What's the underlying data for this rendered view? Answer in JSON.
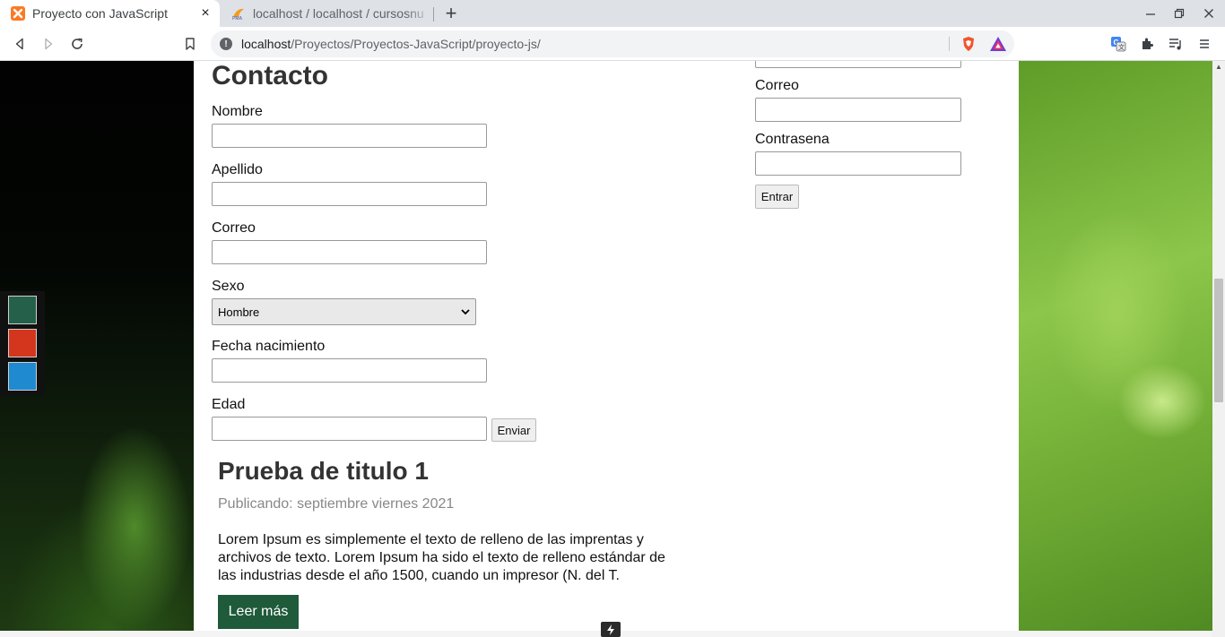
{
  "browser": {
    "tabs": [
      {
        "title": "Proyecto con JavaScript",
        "active": true,
        "favicon": "xampp-icon"
      },
      {
        "title": "localhost / localhost / cursosnu",
        "active": false,
        "favicon": "phpmyadmin-icon"
      }
    ],
    "url": {
      "host": "localhost",
      "path": "/Proyectos/Proyectos-JavaScript/proyecto-js/"
    },
    "new_tab_symbol": "+",
    "close_symbol": "×"
  },
  "theme_colors": [
    "#25604a",
    "#d3361c",
    "#1f8ad0"
  ],
  "contact_form": {
    "title": "Contacto",
    "fields": {
      "nombre": "Nombre",
      "apellido": "Apellido",
      "correo": "Correo",
      "sexo": "Sexo",
      "fecha": "Fecha nacimiento",
      "edad": "Edad"
    },
    "sexo_selected": "Hombre",
    "submit_label": "Enviar"
  },
  "login_form": {
    "correo_label": "Correo",
    "contrasena_label": "Contrasena",
    "submit_label": "Entrar"
  },
  "article": {
    "title": "Prueba de titulo 1",
    "date": "Publicando: septiembre viernes 2021",
    "body": "Lorem Ipsum es simplemente el texto de relleno de las imprentas y archivos de texto. Lorem Ipsum ha sido el texto de relleno estándar de las industrias desde el año 1500, cuando un impresor (N. del T.",
    "read_more": "Leer más"
  },
  "colors": {
    "accent_green": "#1f5a3b",
    "chrome_bg": "#dee1e6"
  }
}
